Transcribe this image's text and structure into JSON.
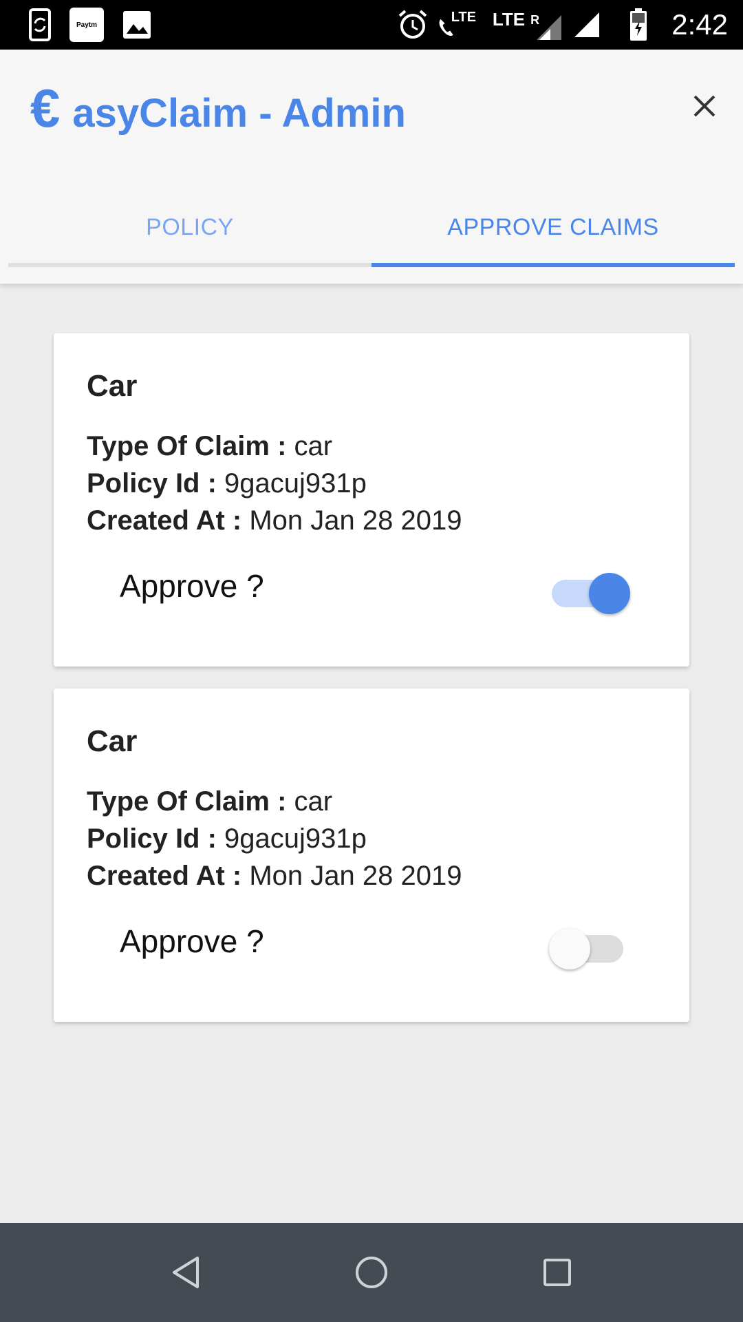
{
  "status_bar": {
    "time": "2:42",
    "paytm_label": "Paytm",
    "lte1": "LTE",
    "lte2": "LTE",
    "roaming": "R",
    "icons": [
      "screen-rotation-icon",
      "paytm-icon",
      "image-icon",
      "alarm-icon",
      "volte-call-icon",
      "signal-icon",
      "signal-icon",
      "battery-icon"
    ]
  },
  "header": {
    "brand_symbol": "€",
    "brand_text": "asyClaim - Admin",
    "close_icon": "close-icon",
    "accent_color": "#4a86e8"
  },
  "tabs": [
    {
      "label": "POLICY",
      "active": false
    },
    {
      "label": "APPROVE CLAIMS",
      "active": true
    }
  ],
  "claims": [
    {
      "title": "Car",
      "type_label": "Type Of Claim : ",
      "type_value": "car",
      "policy_label": "Policy Id : ",
      "policy_value": "9gacuj931p",
      "created_label": "Created At : ",
      "created_value": "Mon Jan 28 2019",
      "approve_label": "Approve ?",
      "approved": true
    },
    {
      "title": "Car",
      "type_label": "Type Of Claim : ",
      "type_value": "car",
      "policy_label": "Policy Id : ",
      "policy_value": "9gacuj931p",
      "created_label": "Created At : ",
      "created_value": "Mon Jan 28 2019",
      "approve_label": "Approve ?",
      "approved": false
    }
  ],
  "nav_bar": {
    "icons": [
      "back-icon",
      "home-icon",
      "recents-icon"
    ]
  }
}
